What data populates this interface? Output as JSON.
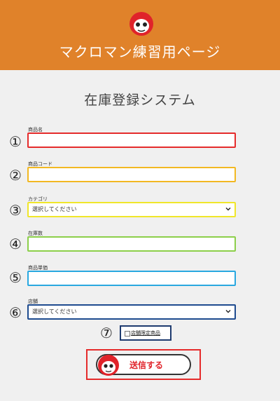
{
  "header": {
    "site_title": "マクロマン練習用ページ",
    "logo_icon": "robot-mascot-icon",
    "background_color": "#e0822a"
  },
  "page": {
    "title": "在庫登録システム"
  },
  "fields": [
    {
      "number": "①",
      "label": "商品名",
      "value": "",
      "border_color": "#e52b2b"
    },
    {
      "number": "②",
      "label": "商品コード",
      "value": "",
      "border_color": "#f2b822"
    },
    {
      "number": "③",
      "label": "カテゴリ",
      "selected": "選択してください",
      "border_color": "#f0e62a"
    },
    {
      "number": "④",
      "label": "在庫数",
      "value": "",
      "border_color": "#8ccf4a"
    },
    {
      "number": "⑤",
      "label": "商品単価",
      "value": "",
      "border_color": "#29a8e0"
    },
    {
      "number": "⑥",
      "label": "店舗",
      "selected": "選択してください",
      "border_color": "#1e4b8f"
    }
  ],
  "checkbox": {
    "number": "⑦",
    "label": "店舗限定商品",
    "checked": false,
    "border_color": "#1e3b6f"
  },
  "submit": {
    "label": "送信する",
    "icon": "robot-mascot-icon",
    "frame_color": "#e52b2b"
  }
}
